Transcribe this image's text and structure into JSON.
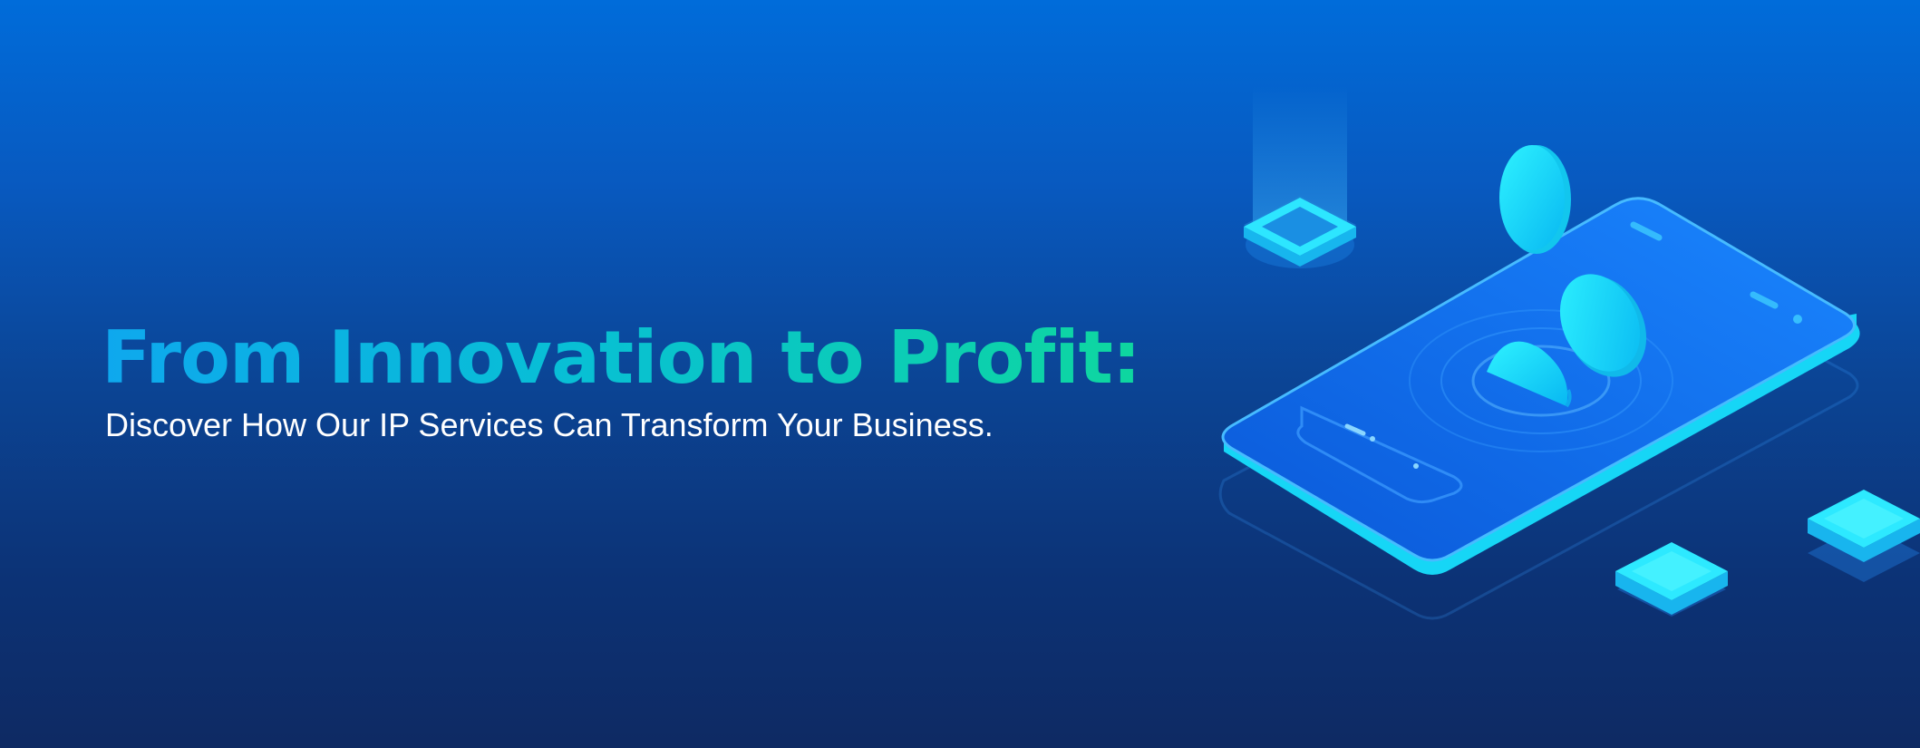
{
  "hero": {
    "headline": "From Innovation to Profit:",
    "subheadline": "Discover How Our IP Services Can Transform Your Business."
  },
  "illustration": {
    "icons": [
      "isometric-phone-icon",
      "coin-icon",
      "glowing-cube-icon"
    ]
  },
  "colors": {
    "background_top": "#006cda",
    "background_bottom": "#0e2a63",
    "headline_gradient_start": "#0ea8ee",
    "headline_gradient_end": "#0ed79f",
    "subheadline": "#ffffff",
    "accent_cyan": "#12e6f5"
  }
}
